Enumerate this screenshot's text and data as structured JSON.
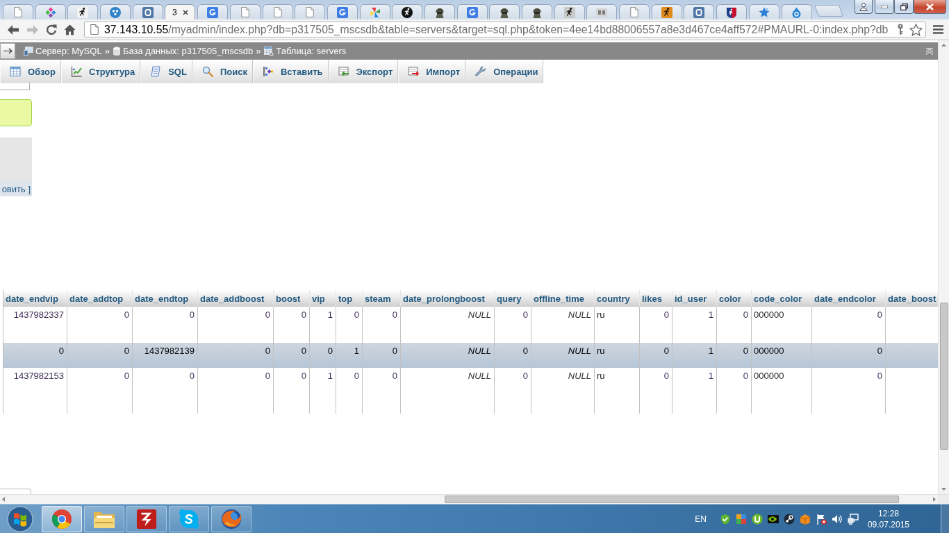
{
  "browser": {
    "tabs": [
      {
        "selected": false
      },
      {
        "selected": false
      },
      {
        "selected": false
      },
      {
        "selected": false
      },
      {
        "selected": false
      },
      {
        "title": "3",
        "selected": true
      },
      {
        "selected": false
      },
      {
        "selected": false
      },
      {
        "selected": false
      },
      {
        "selected": false
      },
      {
        "selected": false
      },
      {
        "selected": false
      },
      {
        "selected": false
      },
      {
        "selected": false
      },
      {
        "selected": false
      },
      {
        "selected": false
      },
      {
        "selected": false
      },
      {
        "selected": false
      },
      {
        "selected": false
      },
      {
        "selected": false
      },
      {
        "selected": false
      },
      {
        "selected": false
      },
      {
        "selected": false
      },
      {
        "selected": false
      },
      {
        "selected": false
      }
    ],
    "nav_buttons": [
      {
        "disabled": false
      },
      {
        "disabled": true
      }
    ],
    "address": {
      "host": "37.143.10.55",
      "path": "/myadmin/index.php?db=p317505_mscsdb&table=servers&target=sql.php&token=4ee14bd88006557a8e3d467ce4aff572#PMAURL-0:index.php?db"
    }
  },
  "breadcrumb": [
    {
      "label": "Сервер: MySQL",
      "separator": "»"
    },
    {
      "label": "База данных: p317505_mscsdb",
      "separator": "»"
    },
    {
      "label": "Таблица: servers"
    }
  ],
  "nav_tabs": [
    "Обзор",
    "Структура",
    "SQL",
    "Поиск",
    "Вставить",
    "Экспорт",
    "Импорт",
    "Операции"
  ],
  "side_panel": {
    "link": "овить ]"
  },
  "table": {
    "columns": [
      {
        "label": "date_endvip",
        "kind": "number"
      },
      {
        "label": "date_addtop",
        "kind": "number"
      },
      {
        "label": "date_endtop",
        "kind": "number"
      },
      {
        "label": "date_addboost",
        "kind": "number"
      },
      {
        "label": "boost",
        "kind": "number"
      },
      {
        "label": "vip",
        "kind": "number"
      },
      {
        "label": "top",
        "kind": "number"
      },
      {
        "label": "steam",
        "kind": "number"
      },
      {
        "label": "date_prolongboost",
        "kind": "number"
      },
      {
        "label": "query",
        "kind": "number"
      },
      {
        "label": "offline_time",
        "kind": "number"
      },
      {
        "label": "country",
        "kind": "text"
      },
      {
        "label": "likes",
        "kind": "number"
      },
      {
        "label": "id_user",
        "kind": "number"
      },
      {
        "label": "color",
        "kind": "number"
      },
      {
        "label": "code_color",
        "kind": "text"
      },
      {
        "label": "date_endcolor",
        "kind": "number"
      },
      {
        "label": "date_boost",
        "kind": "number"
      }
    ],
    "rows": [
      {
        "selected": false,
        "cells": [
          {
            "value": "1437982337",
            "null": false
          },
          {
            "value": "0",
            "null": false
          },
          {
            "value": "0",
            "null": false
          },
          {
            "value": "0",
            "null": false
          },
          {
            "value": "0",
            "null": false
          },
          {
            "value": "1",
            "null": false
          },
          {
            "value": "0",
            "null": false
          },
          {
            "value": "0",
            "null": false
          },
          {
            "value": "NULL",
            "null": true
          },
          {
            "value": "0",
            "null": false
          },
          {
            "value": "NULL",
            "null": true
          },
          {
            "value": "ru",
            "null": false
          },
          {
            "value": "0",
            "null": false
          },
          {
            "value": "1",
            "null": false
          },
          {
            "value": "0",
            "null": false
          },
          {
            "value": "000000",
            "null": false
          },
          {
            "value": "0",
            "null": false
          }
        ]
      },
      {
        "selected": true,
        "cells": [
          {
            "value": "0",
            "null": false
          },
          {
            "value": "0",
            "null": false
          },
          {
            "value": "1437982139",
            "null": false
          },
          {
            "value": "0",
            "null": false
          },
          {
            "value": "0",
            "null": false
          },
          {
            "value": "0",
            "null": false
          },
          {
            "value": "1",
            "null": false
          },
          {
            "value": "0",
            "null": false
          },
          {
            "value": "NULL",
            "null": true
          },
          {
            "value": "0",
            "null": false
          },
          {
            "value": "NULL",
            "null": true
          },
          {
            "value": "ru",
            "null": false
          },
          {
            "value": "0",
            "null": false
          },
          {
            "value": "1",
            "null": false
          },
          {
            "value": "0",
            "null": false
          },
          {
            "value": "000000",
            "null": false
          },
          {
            "value": "0",
            "null": false
          }
        ]
      },
      {
        "selected": false,
        "cells": [
          {
            "value": "1437982153",
            "null": false
          },
          {
            "value": "0",
            "null": false
          },
          {
            "value": "0",
            "null": false
          },
          {
            "value": "0",
            "null": false
          },
          {
            "value": "0",
            "null": false
          },
          {
            "value": "1",
            "null": false
          },
          {
            "value": "0",
            "null": false
          },
          {
            "value": "0",
            "null": false
          },
          {
            "value": "NULL",
            "null": true
          },
          {
            "value": "0",
            "null": false
          },
          {
            "value": "NULL",
            "null": true
          },
          {
            "value": "ru",
            "null": false
          },
          {
            "value": "0",
            "null": false
          },
          {
            "value": "1",
            "null": false
          },
          {
            "value": "0",
            "null": false
          },
          {
            "value": "000000",
            "null": false
          },
          {
            "value": "0",
            "null": false
          }
        ]
      }
    ]
  },
  "taskbar": {
    "apps": [
      {
        "selected": true
      },
      {
        "selected": false
      },
      {
        "selected": false
      },
      {
        "selected": false
      },
      {
        "selected": false
      }
    ],
    "language": "EN",
    "time": "12:28",
    "date": "09.07.2015"
  }
}
